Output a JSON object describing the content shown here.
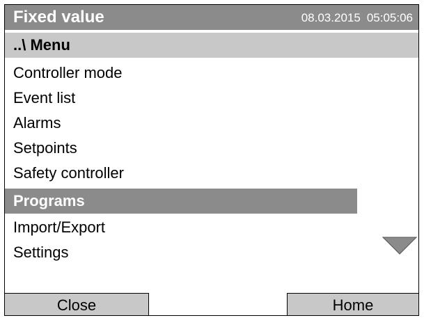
{
  "header": {
    "title": "Fixed value",
    "date": "08.03.2015",
    "time": "05:05:06"
  },
  "menu": {
    "parent_label": "..\\ Menu",
    "items": [
      {
        "label": "Controller mode"
      },
      {
        "label": "Event list"
      },
      {
        "label": "Alarms"
      },
      {
        "label": "Setpoints"
      },
      {
        "label": "Safety controller"
      },
      {
        "label": "Programs",
        "selected": true
      },
      {
        "label": "Import/Export"
      },
      {
        "label": "Settings"
      }
    ]
  },
  "buttons": {
    "close_label": "Close",
    "home_label": "Home"
  },
  "icons": {
    "scroll_down": "triangle-down-icon"
  },
  "colors": {
    "title_bar": "#8b8b8b",
    "selected_item": "#8b8b8b",
    "header_band": "#c8c8c8",
    "button_face": "#c8c8c8"
  }
}
